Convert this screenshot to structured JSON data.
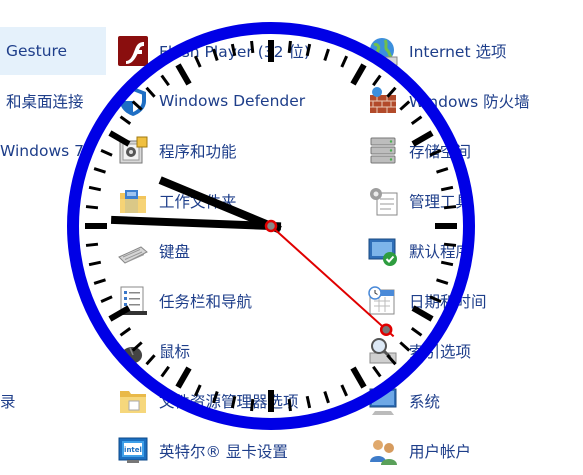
{
  "items": {
    "c0": [
      "Gesture",
      "和桌面连接",
      "Windows 7",
      "",
      "",
      "",
      "",
      "录"
    ],
    "c1": [
      "Flash Player (32 位)",
      "Windows Defender",
      "程序和功能",
      "工作文件夹",
      "键盘",
      "任务栏和导航",
      "鼠标",
      "文件资源管理器选项",
      "英特尔® 显卡设置"
    ],
    "c2": [
      "Internet 选项",
      "Windows 防火墙",
      "存储空间",
      "管理工具",
      "默认程序",
      "日期和时间",
      "索引选项",
      "系统",
      "用户帐户"
    ]
  },
  "icons": {
    "c1": [
      "flash-player-icon",
      "windows-defender-icon",
      "programs-and-features-icon",
      "work-folders-icon",
      "keyboard-icon",
      "taskbar-navigation-icon",
      "mouse-icon",
      "file-explorer-options-icon",
      "intel-graphics-icon"
    ],
    "c2": [
      "internet-options-icon",
      "windows-firewall-icon",
      "storage-spaces-icon",
      "administrative-tools-icon",
      "default-programs-icon",
      "date-time-icon",
      "indexing-options-icon",
      "system-icon",
      "user-accounts-icon"
    ]
  },
  "clock": {
    "hour": 9,
    "minute": 45,
    "second": 22,
    "face_color": "#0000e6",
    "hand_color": "#000000",
    "second_hand_color": "#e00000"
  },
  "colors": {
    "link_text": "#1e3e8a",
    "selection": "#e5f1fb"
  }
}
